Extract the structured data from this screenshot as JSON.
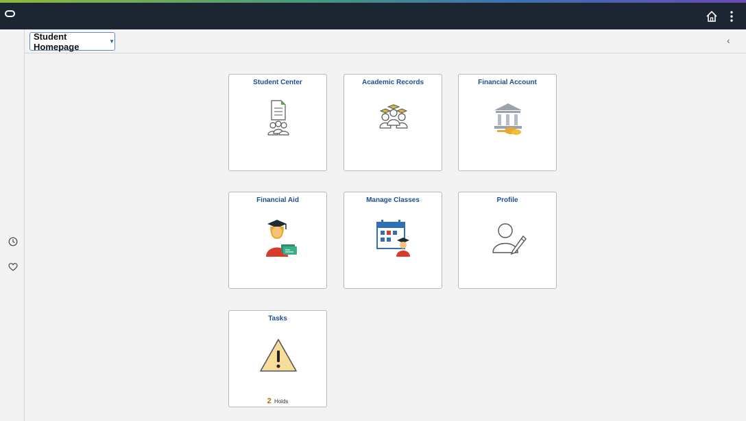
{
  "header": {
    "logo_icon": "oracle-ring-icon",
    "home_icon": "home-icon",
    "actions_icon": "kebab-menu-icon"
  },
  "page": {
    "homepage_selector": "Student Homepage",
    "collapse_icon": "chevron-left-icon"
  },
  "left_rail": {
    "recent_icon": "clock-icon",
    "favorites_icon": "heart-icon"
  },
  "tiles": [
    {
      "title": "Student Center",
      "icon": "student-center-icon"
    },
    {
      "title": "Academic Records",
      "icon": "academic-records-icon"
    },
    {
      "title": "Financial Account",
      "icon": "bank-icon"
    },
    {
      "title": "Financial Aid",
      "icon": "graduate-money-icon"
    },
    {
      "title": "Manage Classes",
      "icon": "calendar-graduate-icon"
    },
    {
      "title": "Profile",
      "icon": "profile-edit-icon"
    },
    {
      "title": "Tasks",
      "icon": "warning-icon",
      "count": "2",
      "count_label": "Holds"
    }
  ],
  "colors": {
    "topbar": "#1c2632",
    "tile_title": "#1d4f90",
    "count": "#b36a00"
  }
}
